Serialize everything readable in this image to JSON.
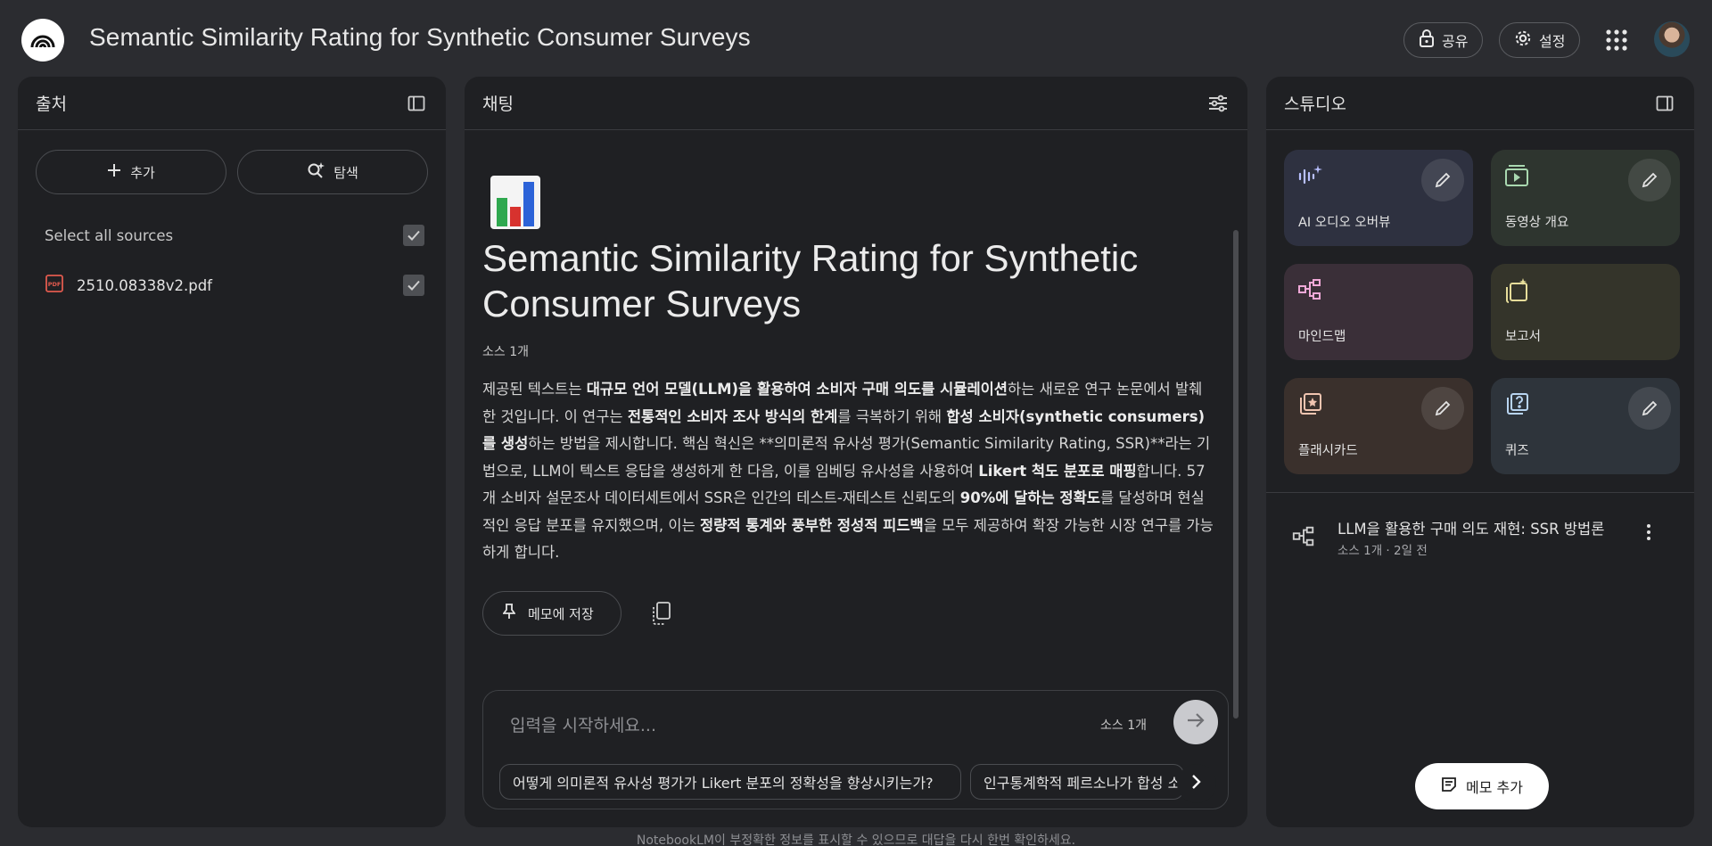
{
  "header": {
    "title": "Semantic Similarity Rating for Synthetic Consumer Surveys",
    "share_label": "공유",
    "settings_label": "설정"
  },
  "sources": {
    "title": "출처",
    "add_label": "추가",
    "explore_label": "탐색",
    "select_all_label": "Select all sources",
    "items": [
      {
        "name": "2510.08338v2.pdf",
        "checked": true
      }
    ]
  },
  "chat": {
    "title": "채팅",
    "doc_title": "Semantic Similarity Rating for Synthetic Consumer Surveys",
    "source_count": "소스 1개",
    "summary": {
      "p1": "제공된 텍스트는 ",
      "b1": "대규모 언어 모델(LLM)을 활용하여 소비자 구매 의도를 시뮬레이션",
      "p2": "하는 새로운 연구 논문에서 발췌한 것입니다. 이 연구는 ",
      "b2": "전통적인 소비자 조사 방식의 한계",
      "p3": "를 극복하기 위해 ",
      "b3": "합성 소비자(synthetic consumers)를 생성",
      "p4": "하는 방법을 제시합니다. 핵심 혁신은 **의미론적 유사성 평가(Semantic Similarity Rating, SSR)**라는 기법으로, LLM이 텍스트 응답을 생성하게 한 다음, 이를 임베딩 유사성을 사용하여 ",
      "b4": "Likert 척도 분포로 매핑",
      "p5": "합니다. 57개 소비자 설문조사 데이터세트에서 SSR은 인간의 테스트-재테스트 신뢰도의 ",
      "b5": "90%에 달하는 정확도",
      "p6": "를 달성하며 현실적인 응답 분포를 유지했으며, 이는 ",
      "b6": "정량적 통계와 풍부한 정성적 피드백",
      "p7": "을 모두 제공하여 확장 가능한 시장 연구를 가능하게 합니다."
    },
    "save_memo_label": "메모에 저장",
    "input_placeholder": "입력을 시작하세요...",
    "input_source_count": "소스 1개",
    "suggestions": [
      "어떻게 의미론적 유사성 평가가 Likert 분포의 정확성을 향상시키는가?",
      "인구통계학적 페르소나가 합성 소비자"
    ]
  },
  "studio": {
    "title": "스튜디오",
    "tiles": [
      {
        "label": "AI 오디오 오버뷰",
        "icon": "audio-waveform-icon",
        "color": "#2e3140",
        "editable": true
      },
      {
        "label": "동영상 개요",
        "icon": "video-icon",
        "color": "#2e352f",
        "editable": true
      },
      {
        "label": "마인드맵",
        "icon": "mindmap-icon",
        "color": "#3a2f38",
        "editable": false
      },
      {
        "label": "보고서",
        "icon": "report-icon",
        "color": "#34342a",
        "editable": false
      },
      {
        "label": "플래시카드",
        "icon": "flashcard-icon",
        "color": "#3a302c",
        "editable": true
      },
      {
        "label": "퀴즈",
        "icon": "quiz-icon",
        "color": "#2e343b",
        "editable": true
      }
    ],
    "notes": [
      {
        "title": "LLM을 활용한 구매 의도 재현: SSR 방법론",
        "meta": "소스 1개 · 2일 전"
      }
    ],
    "add_note_label": "메모 추가"
  },
  "footer": {
    "disclaimer": "NotebookLM이 부정확한 정보를 표시할 수 있으므로 대답을 다시 한번 확인하세요."
  }
}
